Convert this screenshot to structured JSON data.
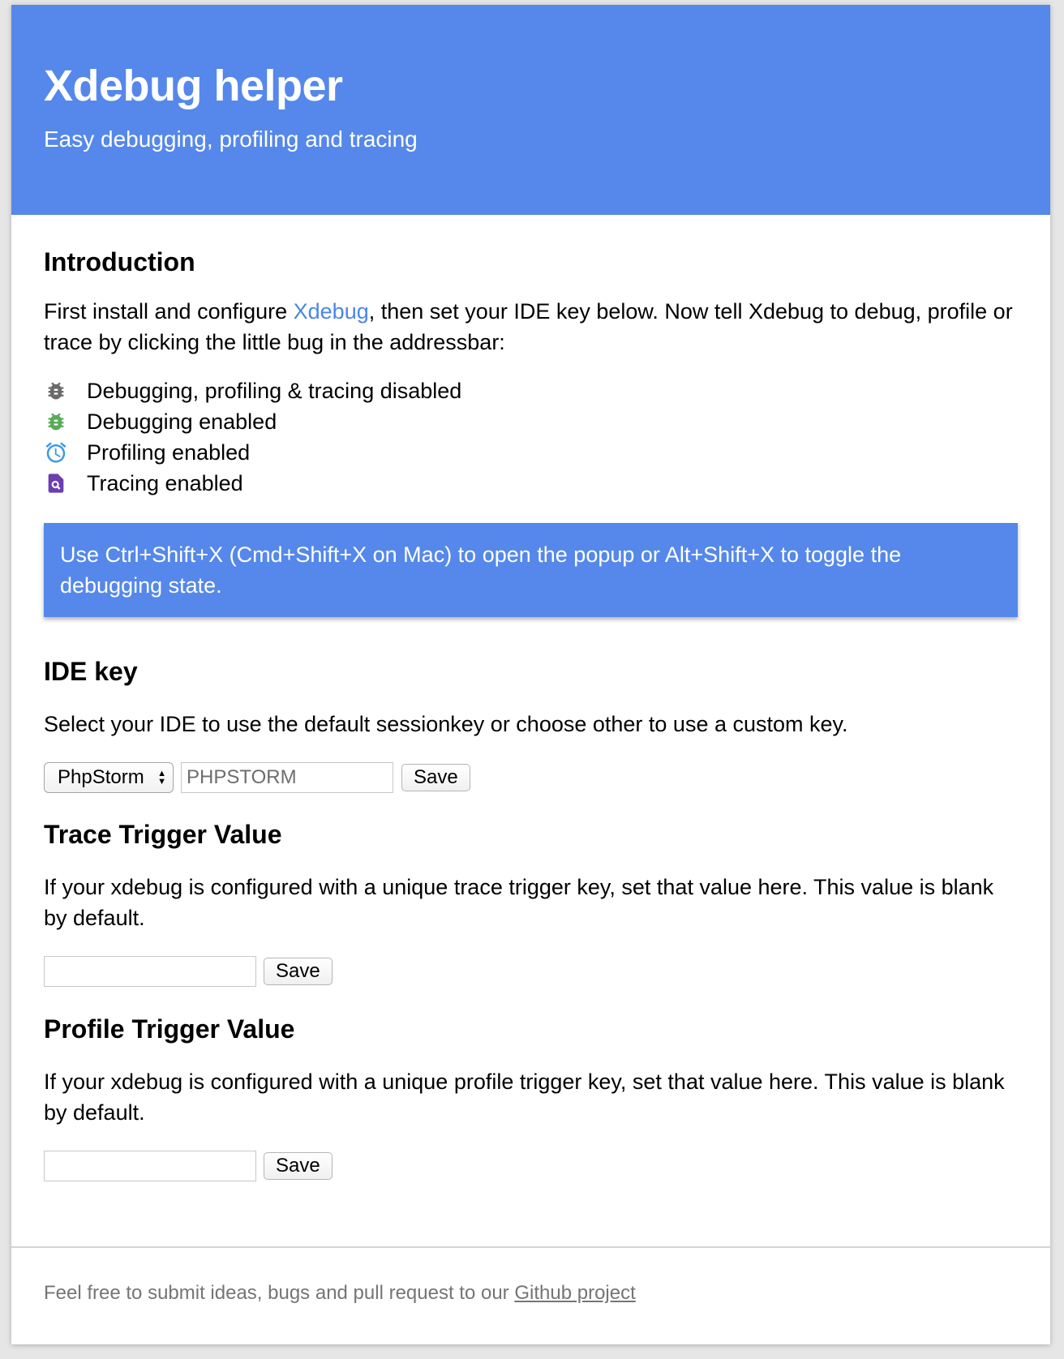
{
  "header": {
    "title": "Xdebug helper",
    "subtitle": "Easy debugging, profiling and tracing"
  },
  "intro": {
    "heading": "Introduction",
    "text_before_link": "First install and configure ",
    "link_text": "Xdebug",
    "text_after_link": ", then set your IDE key below. Now tell Xdebug to debug, profile or trace by clicking the little bug in the addressbar:",
    "legend": [
      {
        "icon": "bug-gray-icon",
        "color": "#6b6b6b",
        "label": "Debugging, profiling & tracing disabled"
      },
      {
        "icon": "bug-green-icon",
        "color": "#5aaa5a",
        "label": "Debugging enabled"
      },
      {
        "icon": "alarm-clock-icon",
        "color": "#3d9be3",
        "label": "Profiling enabled"
      },
      {
        "icon": "trace-search-icon",
        "color": "#6a3fb0",
        "label": "Tracing enabled"
      }
    ],
    "shortcut_notice": "Use Ctrl+Shift+X (Cmd+Shift+X on Mac) to open the popup or Alt+Shift+X to toggle the debugging state."
  },
  "ide_key": {
    "heading": "IDE key",
    "description": "Select your IDE to use the default sessionkey or choose other to use a custom key.",
    "selected_ide": "PhpStorm",
    "key_value": "PHPSTORM",
    "save_label": "Save"
  },
  "trace_trigger": {
    "heading": "Trace Trigger Value",
    "description": "If your xdebug is configured with a unique trace trigger key, set that value here. This value is blank by default.",
    "value": "",
    "save_label": "Save"
  },
  "profile_trigger": {
    "heading": "Profile Trigger Value",
    "description": "If your xdebug is configured with a unique profile trigger key, set that value here. This value is blank by default.",
    "value": "",
    "save_label": "Save"
  },
  "footer": {
    "text": "Feel free to submit ideas, bugs and pull request to our ",
    "link_text": "Github project"
  },
  "colors": {
    "accent": "#5588ea",
    "link": "#4a86e8"
  }
}
